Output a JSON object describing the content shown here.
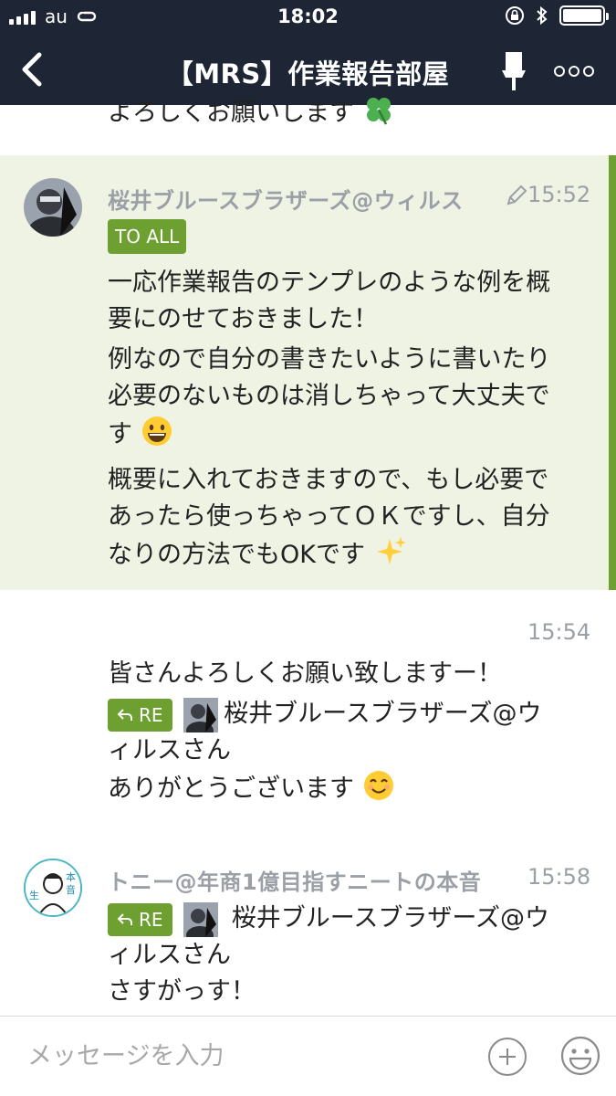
{
  "status_bar": {
    "carrier": "au",
    "time": "18:02"
  },
  "header": {
    "room_title": "【MRS】作業報告部屋"
  },
  "messages": {
    "previous_tail": "よろしくお願いします",
    "m1": {
      "sender": "桜井ブルースブラザーズ@ウィルス",
      "time": "15:52",
      "tag": "TO ALL",
      "lines": [
        "一応作業報告のテンプレのような例を概",
        "要にのせておきました！",
        "例なので自分の書きたいように書いたり",
        "必要のないものは消しちゃって大丈夫で",
        "す",
        "概要に入れておきますので、もし必要で",
        "あったら使っちゃってＯＫですし、自分",
        "なりの方法でもOKです"
      ]
    },
    "m2": {
      "time": "15:54",
      "line1": "皆さんよろしくお願い致しますー！",
      "re_label": "RE",
      "reply_to": "桜井ブルースブラザーズ@ウ",
      "reply_to_cont": "ィルスさん",
      "line_last": "ありがとうございます"
    },
    "m3": {
      "sender": "トニー@年商1億目指すニートの本音",
      "time": "15:58",
      "re_label": "RE",
      "reply_to": "桜井ブルースブラザーズ@ウ",
      "reply_to_cont": "ィルスさん",
      "line_last": "さすがっす！"
    }
  },
  "input": {
    "placeholder": "メッセージを入力"
  },
  "colors": {
    "header_bg": "#1e2635",
    "accent_green": "#6da030",
    "highlight_bg": "#eef3e4"
  }
}
